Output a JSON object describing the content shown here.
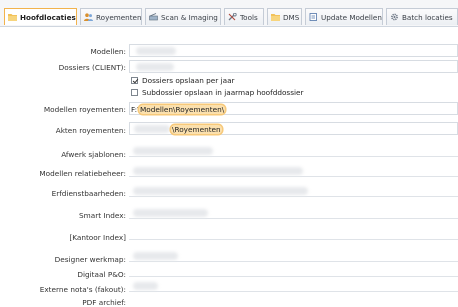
{
  "tabs": [
    {
      "label": "Hoofdlocaties",
      "icon": "folder-icon",
      "active": true
    },
    {
      "label": "Royementen",
      "icon": "people-icon",
      "active": false
    },
    {
      "label": "Scan & Imaging",
      "icon": "scanner-icon",
      "active": false
    },
    {
      "label": "Tools",
      "icon": "tools-icon",
      "active": false
    },
    {
      "label": "DMS",
      "icon": "folder-icon",
      "active": false
    },
    {
      "label": "Update Modellen",
      "icon": "update-icon",
      "active": false
    },
    {
      "label": "Batch locaties",
      "icon": "gear-icon",
      "active": false
    }
  ],
  "form": {
    "modellen_label": "Modellen:",
    "dossiers_label": "Dossiers (CLIENT):",
    "cb_per_jaar": "Dossiers opslaan per jaar",
    "cb_subdossier": "Subdossier opslaan in jaarmap hoofddossier",
    "modellen_royementen_label": "Modellen royementen:",
    "modellen_royementen_prefix": "F:\\",
    "modellen_royementen_value": "Modellen\\Royementen\\",
    "akten_royementen_label": "Akten royementen:",
    "akten_royementen_value": "\\Royementen",
    "afwerk_label": "Afwerk sjablonen:",
    "relatiebeheer_label": "Modellen relatiebeheer:",
    "erfdienst_label": "Erfdienstbaarheden:",
    "smart_index_label": "Smart Index:",
    "kantoor_index_label": "[Kantoor Index]",
    "designer_label": "Designer werkmap:",
    "digitaal_label": "Digitaal P&O:",
    "externe_label": "Externe nota's (fakout):",
    "pdf_label": "PDF archief:"
  },
  "colors": {
    "highlight": "#fbe0ad",
    "active_tab_border": "#f2b34d"
  }
}
